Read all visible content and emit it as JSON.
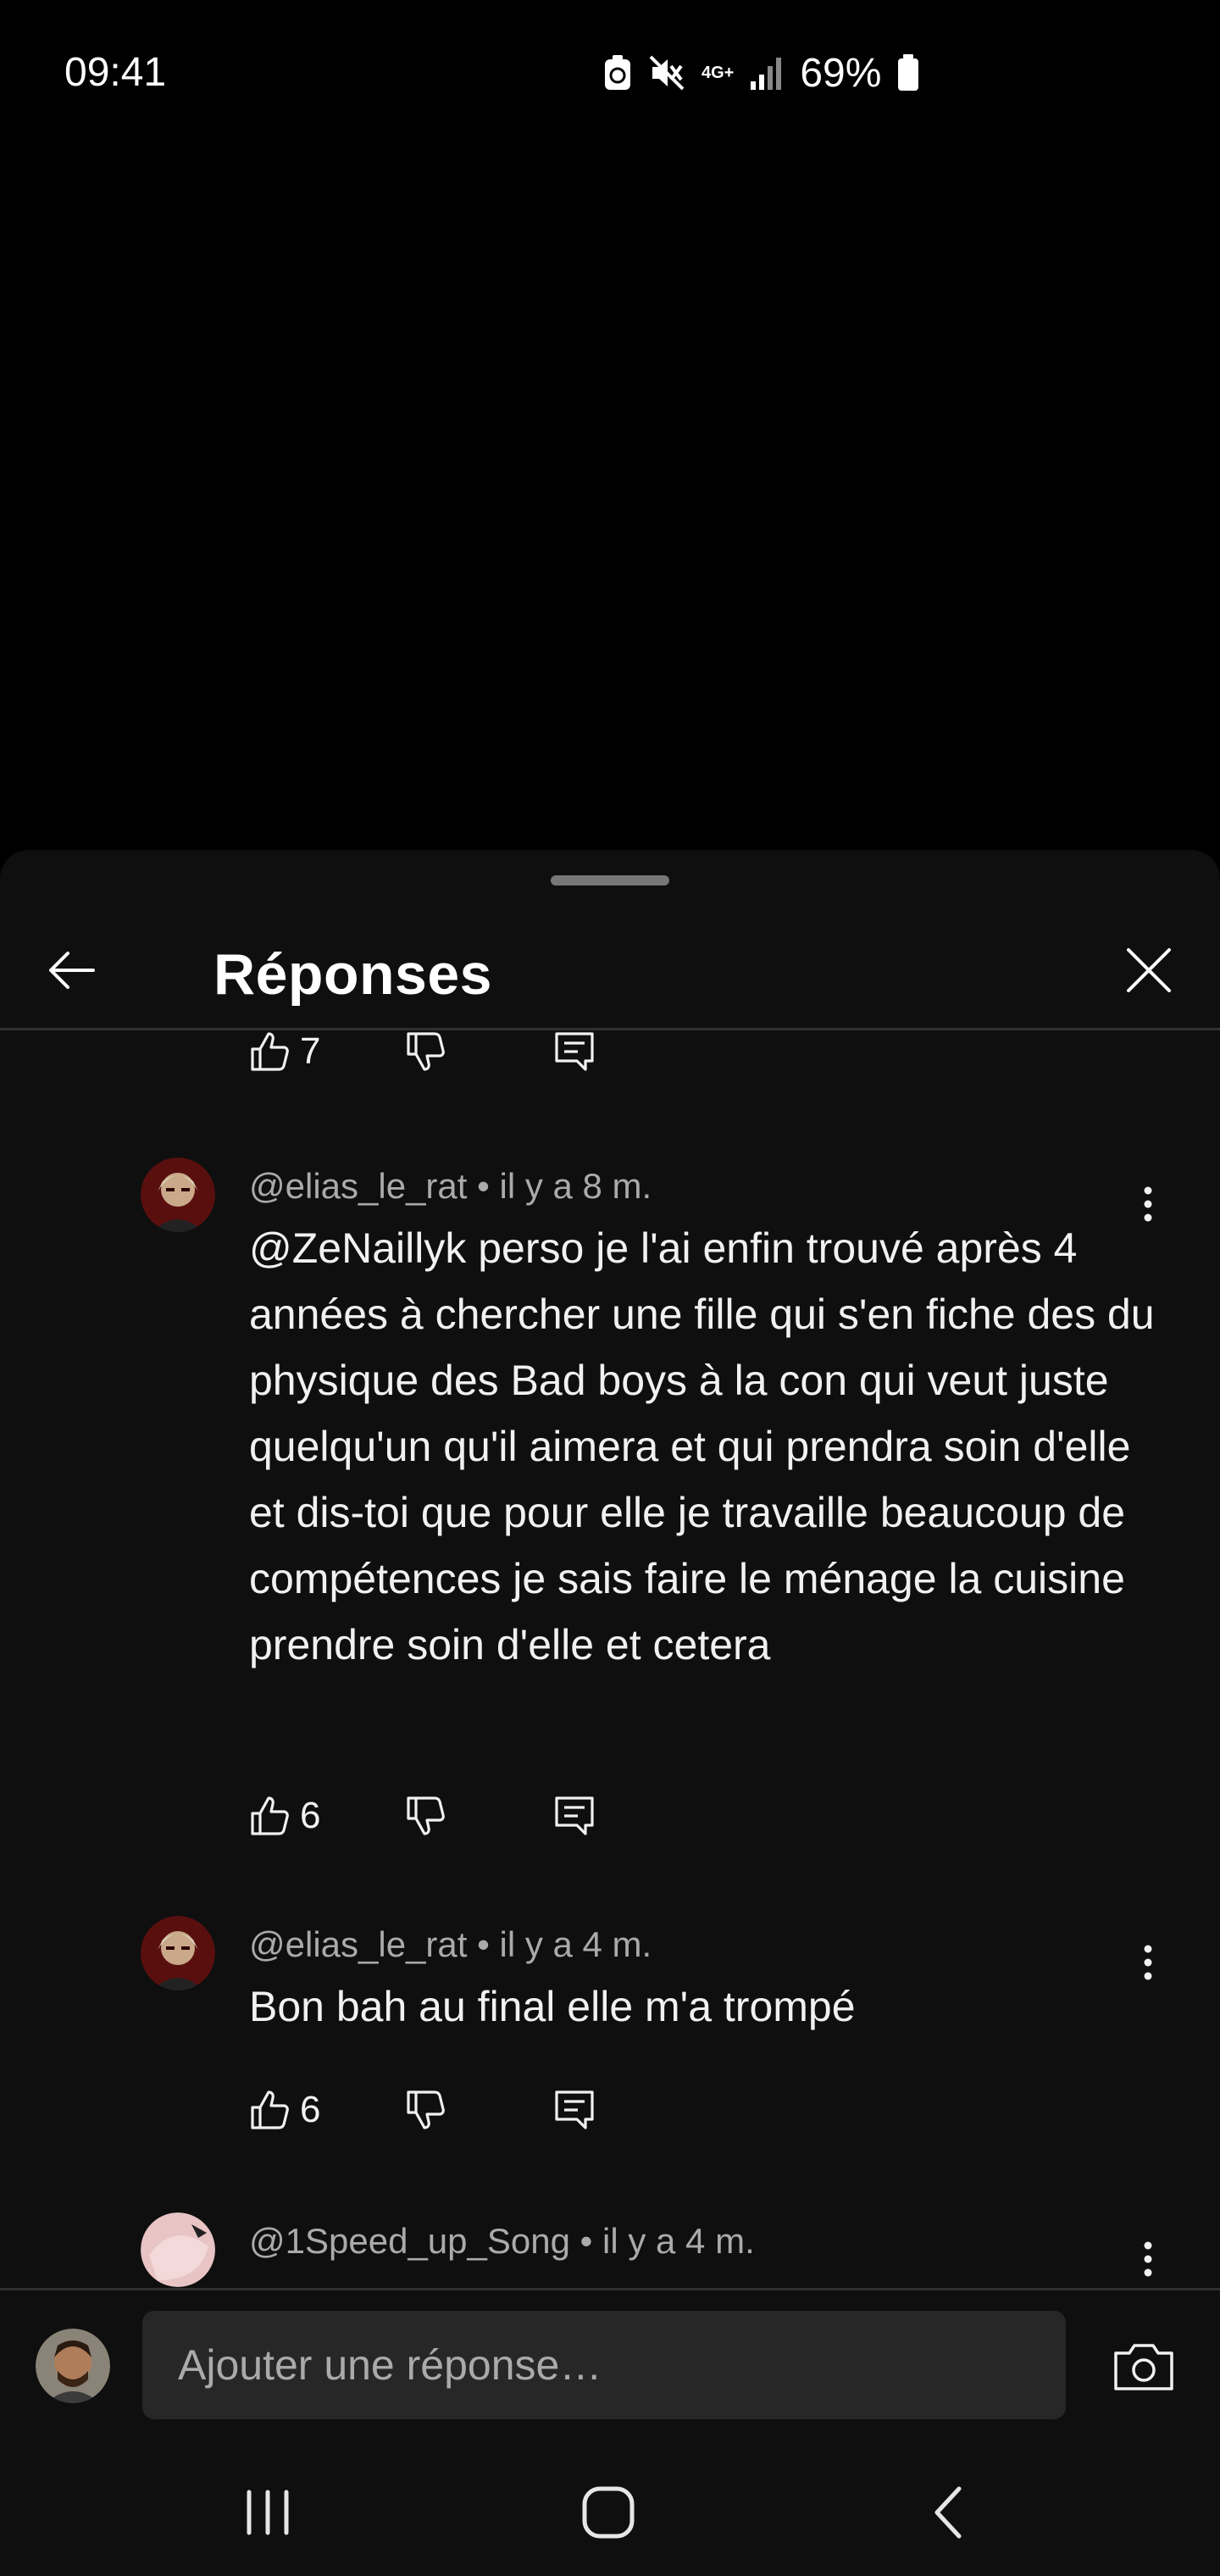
{
  "status_bar": {
    "time": "09:41",
    "network": "4G+",
    "battery": "69%"
  },
  "sheet": {
    "title": "Réponses"
  },
  "comments": [
    {
      "likes": "7"
    },
    {
      "author": "@elias_le_rat",
      "time": "il y a 8 m.",
      "text": "@ZeNaillyk  perso je l'ai enfin trouvé après 4 années à chercher une fille qui s'en fiche des du physique des Bad boys à la con qui veut juste quelqu'un qu'il aimera et qui prendra soin d'elle et dis-toi que pour elle je travaille beaucoup de compétences je sais faire le ménage la cuisine prendre soin d'elle et cetera",
      "likes": "6"
    },
    {
      "author": "@elias_le_rat",
      "time": "il y a 4 m.",
      "text": "Bon bah au final elle m'a trompé",
      "likes": "6"
    },
    {
      "author": "@1Speed_up_Song",
      "time": "il y a 4 m."
    }
  ],
  "meta_separator": "•",
  "reply_bar": {
    "placeholder": "Ajouter une réponse…"
  },
  "icons": {
    "back": "arrow-left-icon",
    "close": "close-icon",
    "like": "thumbs-up-icon",
    "dislike": "thumbs-down-icon",
    "reply": "comment-icon",
    "more": "more-vert-icon",
    "camera": "camera-icon",
    "nav_recents": "recents-icon",
    "nav_home": "home-icon",
    "nav_back": "chevron-left-icon"
  },
  "colors": {
    "background": "#000000",
    "sheet": "#0f0f0f",
    "input": "#272727",
    "text_primary": "#f1f1f1",
    "text_secondary": "#aaaaaa"
  }
}
